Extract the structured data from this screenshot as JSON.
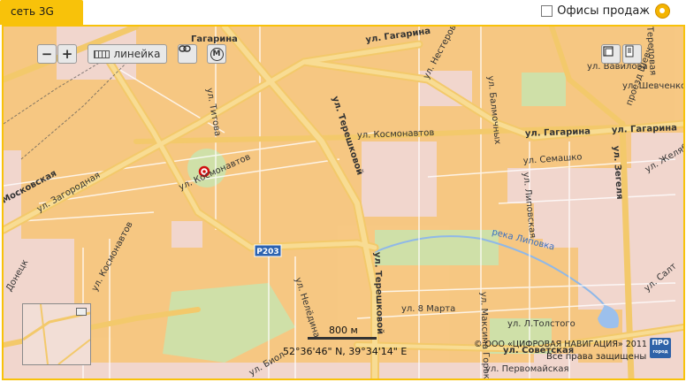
{
  "tab": {
    "label": "сеть 3G"
  },
  "offices": {
    "label": "Офисы продаж"
  },
  "controls": {
    "zoom_out": "−",
    "zoom_in": "+",
    "ruler_label": "линейка",
    "metro_label": "М"
  },
  "map": {
    "streets": {
      "gagarina_top": "ул. Гагарина",
      "gagarina_left": "Гагарина",
      "gagarina_right1": "ул. Гагарина",
      "gagarina_right2": "ул. Гагарина",
      "nesterova": "ул. Нестерова",
      "vavilova": "ул. Вавилова",
      "shevchenko": "ул. Шевченко",
      "kosmonavtov_mid": "ул. Космонавтов",
      "kosmonavtov_left": "ул. Космонавтов",
      "kosmonavtov_bottom": "ул. Космонавтов",
      "moskovskaya": "Московская",
      "zagorodnaya": "ул. Загородная",
      "tereshkovoy_top": "ул. Терешковой",
      "tereshkovoy_bottom": "ул. Терешковой",
      "titova": "ул. Титова",
      "semashko": "ул. Семашко",
      "lipovskaya": "ул. Липовская",
      "zegelya": "ул. Зегеля",
      "zhelyabova": "ул. Желябова",
      "river": "река Липовка",
      "route": "P203",
      "nelyudina": "ул. Нелёдина",
      "marta": "ул. 8 Марта",
      "tolstogo": "ул. Л.Толстого",
      "sovetskaya": "ул. Советская",
      "pervomayskaya": "ул. Первомайская",
      "donetskaya": "Донецк",
      "balmochnykh": "ул. Балмочных",
      "maksima_gorkogo": "ул. Максима Горького",
      "ternovaya": "Тереповая",
      "salt": "ул. Салт",
      "biol": "ул. Биол",
      "proezd": "проезд Шевч"
    }
  },
  "scale": {
    "label": "800 м"
  },
  "coords": {
    "text": "52°36'46\" N, 39°34'14\" E"
  },
  "copyright": {
    "text": "© ООО «ЦИФРОВАЯ НАВИГАЦИЯ» 2011"
  },
  "rights": {
    "text": "Все права защищены"
  },
  "pro_badge": {
    "line1": "ПРО",
    "line2": "город"
  },
  "colors": {
    "accent": "#f8c20a",
    "coverage": "#f7c77e",
    "road": "#f6d27e",
    "base": "#f1d6cd"
  }
}
